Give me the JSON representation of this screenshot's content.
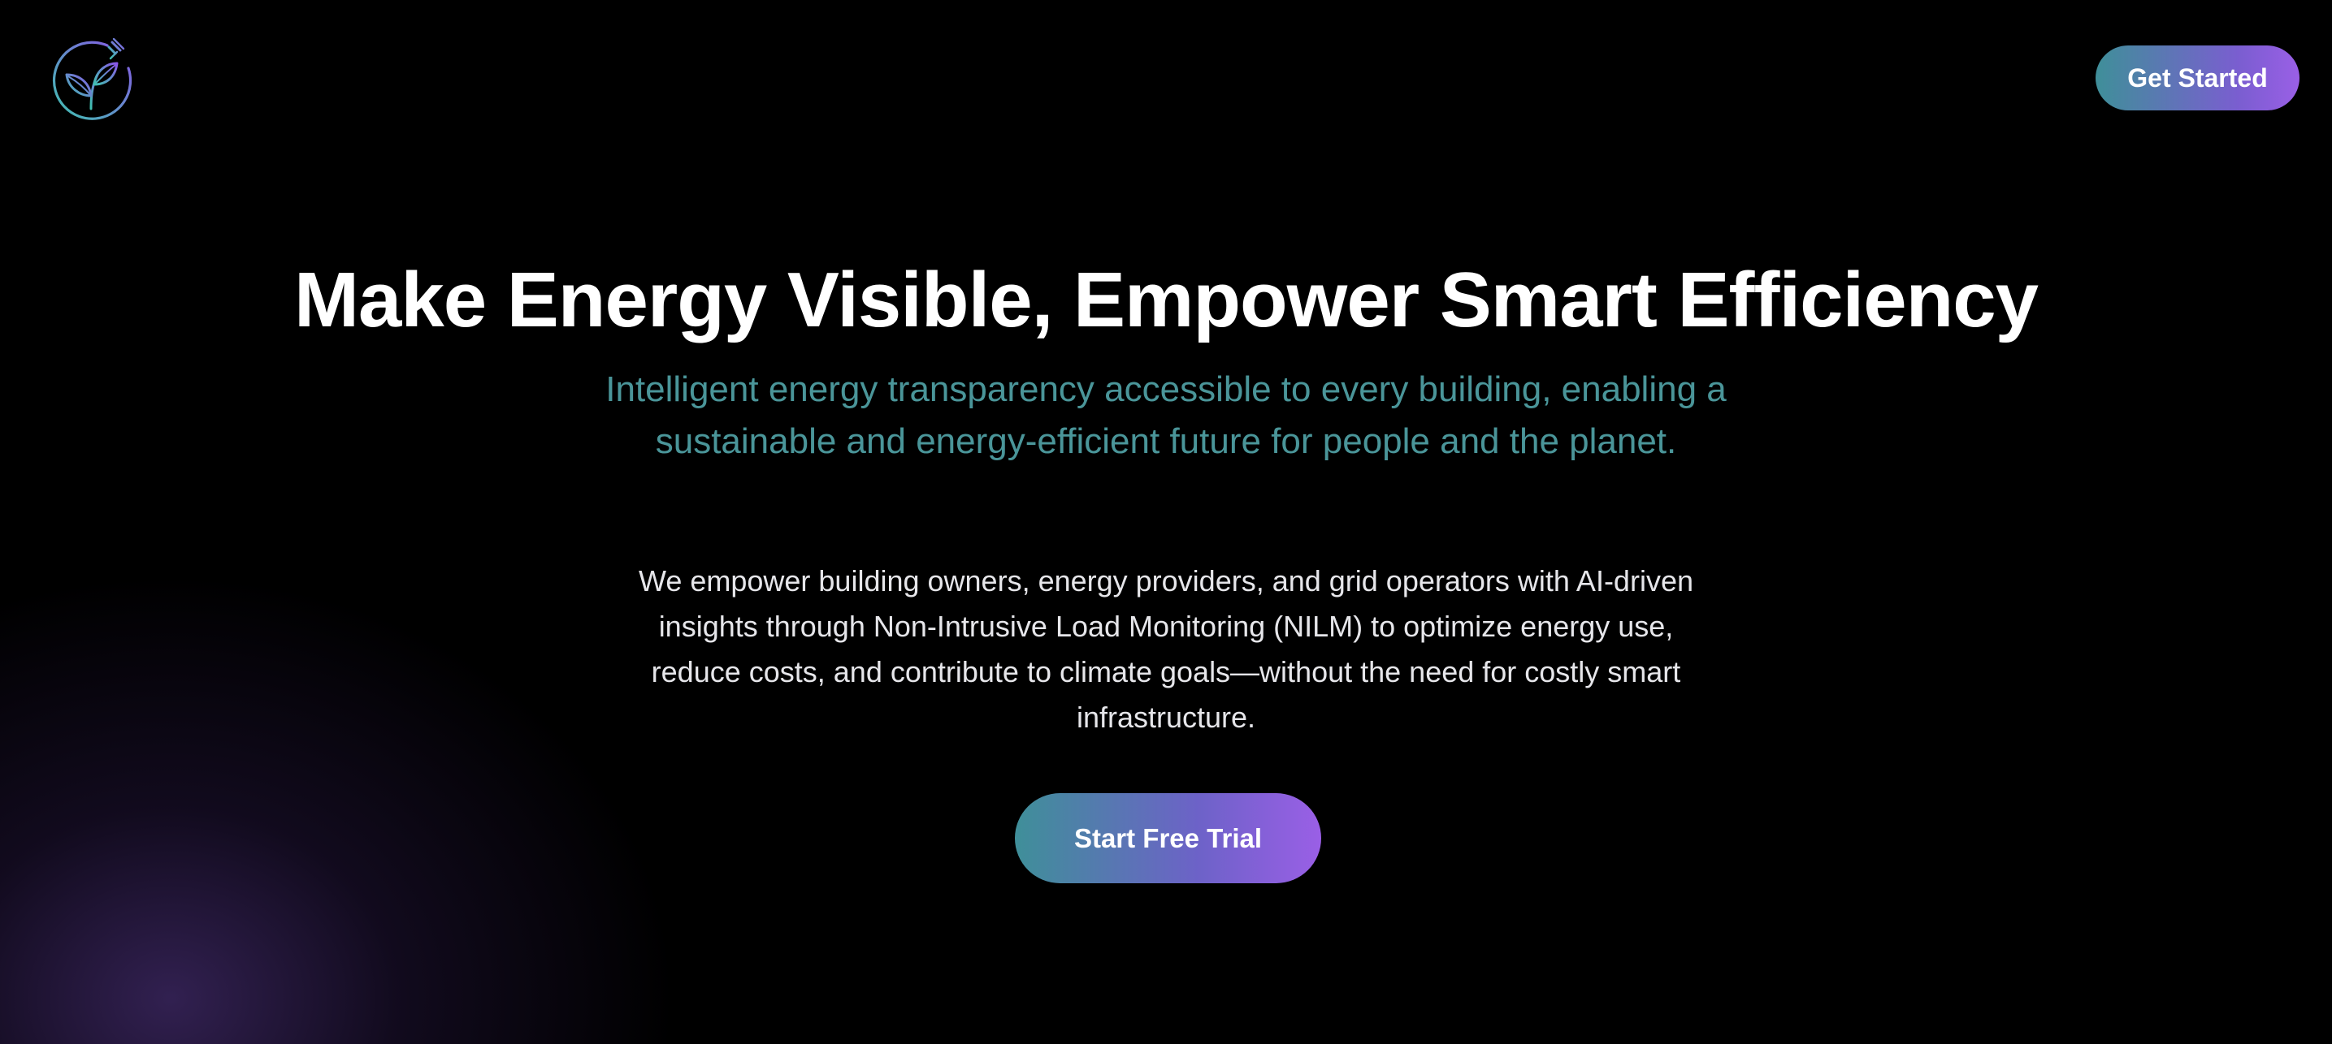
{
  "header": {
    "logo_icon": "leaf-plug-icon",
    "cta_label": "Get Started"
  },
  "hero": {
    "title": "Make Energy Visible, Empower Smart Efficiency",
    "subtitle": "Intelligent energy transparency accessible to every building, enabling a sustainable and energy-efficient future for people and the planet.",
    "body": "We empower building owners, energy providers, and grid operators with AI-driven insights through Non-Intrusive Load Monitoring (NILM) to optimize energy use, reduce costs, and contribute to climate goals—without the need for costly smart infrastructure.",
    "cta_label": "Start Free Trial"
  },
  "colors": {
    "background": "#000000",
    "subtitle_teal": "#4a9599",
    "gradient_start": "#3f8f99",
    "gradient_end": "#9a5fe6",
    "glow_purple": "#503482"
  }
}
